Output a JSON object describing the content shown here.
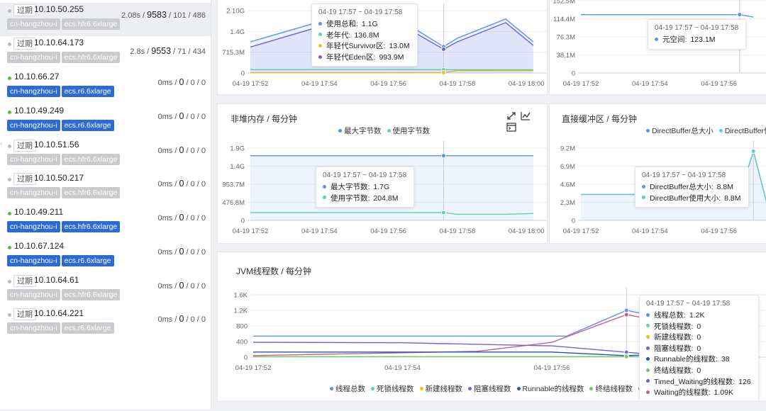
{
  "colors": {
    "blue": "#5b8ff9",
    "green": "#5ad8a6",
    "yellow": "#f6bd16",
    "purple": "#6d63d4",
    "dkblue": "#2952b8",
    "ltgreen": "#73c764",
    "pink": "#c75c94",
    "teal": "#64c9c9"
  },
  "sidebar": {
    "instances": [
      {
        "ip": "10.10.50.255",
        "expired": "过期",
        "status": "grey",
        "tags": [
          {
            "text": "cn-hangzhou-i",
            "c": "grey"
          },
          {
            "text": "ecs.hfr6.6xlarge",
            "c": "grey"
          }
        ],
        "time": "2.08s",
        "sep": " / ",
        "big": "9583",
        "rest": " / 101 / 486",
        "selected": true
      },
      {
        "ip": "10.10.64.173",
        "expired": "过期",
        "status": "grey",
        "tags": [
          {
            "text": "cn-hangzhou-i",
            "c": "grey"
          },
          {
            "text": "ecs.hfr6.6xlarge",
            "c": "grey"
          }
        ],
        "time": "2.8s",
        "sep": " / ",
        "big": "9553",
        "rest": " / 71 / 434"
      },
      {
        "ip": "10.10.66.27",
        "expired": "",
        "status": "green",
        "tags": [
          {
            "text": "cn-hangzhou-i",
            "c": "blue"
          },
          {
            "text": "ecs.r6.6xlarge",
            "c": "blue"
          }
        ],
        "time": "0ms",
        "sep": " / ",
        "big": "0",
        "rest": " / 0 / 0"
      },
      {
        "ip": "10.10.49.249",
        "expired": "",
        "status": "green",
        "tags": [
          {
            "text": "cn-hangzhou-i",
            "c": "blue"
          },
          {
            "text": "ecs.r6.6xlarge",
            "c": "blue"
          }
        ],
        "time": "0ms",
        "sep": " / ",
        "big": "0",
        "rest": " / 0 / 0"
      },
      {
        "ip": "10.10.51.56",
        "expired": "过期",
        "status": "grey",
        "tags": [
          {
            "text": "cn-hangzhou-i",
            "c": "grey"
          },
          {
            "text": "ecs.hfr6.6xlarge",
            "c": "grey"
          }
        ],
        "time": "0ms",
        "sep": " / ",
        "big": "0",
        "rest": " / 0 / 0"
      },
      {
        "ip": "10.10.50.217",
        "expired": "过期",
        "status": "grey",
        "tags": [
          {
            "text": "cn-hangzhou-i",
            "c": "grey"
          },
          {
            "text": "ecs.hfr6.6xlarge",
            "c": "grey"
          }
        ],
        "time": "0ms",
        "sep": " / ",
        "big": "0",
        "rest": " / 0 / 0"
      },
      {
        "ip": "10.10.49.211",
        "expired": "",
        "status": "green",
        "tags": [
          {
            "text": "cn-hangzhou-i",
            "c": "blue"
          },
          {
            "text": "ecs.hfr6.6xlarge",
            "c": "blue"
          }
        ],
        "time": "0ms",
        "sep": " / ",
        "big": "0",
        "rest": " / 0 / 0"
      },
      {
        "ip": "10.10.67.124",
        "expired": "",
        "status": "green",
        "tags": [
          {
            "text": "cn-hangzhou-i",
            "c": "blue"
          },
          {
            "text": "ecs.r6.6xlarge",
            "c": "blue"
          }
        ],
        "time": "0ms",
        "sep": " / ",
        "big": "0",
        "rest": " / 0 / 0"
      },
      {
        "ip": "10.10.64.61",
        "expired": "过期",
        "status": "grey",
        "tags": [
          {
            "text": "cn-hangzhou-i",
            "c": "grey"
          },
          {
            "text": "ecs.hfr6.6xlarge",
            "c": "grey"
          }
        ],
        "time": "0ms",
        "sep": " / ",
        "big": "0",
        "rest": " / 0 / 0"
      },
      {
        "ip": "10.10.64.221",
        "expired": "过期",
        "status": "grey",
        "tags": [
          {
            "text": "cn-hangzhou-i",
            "c": "grey"
          },
          {
            "text": "ecs.r6.6xlarge",
            "c": "grey"
          }
        ],
        "time": "0ms",
        "sep": " / ",
        "big": "0",
        "rest": " / 0 / 0"
      }
    ]
  },
  "chart_data": [
    {
      "id": "heap",
      "type": "area",
      "title": "",
      "x": [
        "04-19 17:52",
        "04-19 17:54",
        "04-19 17:56",
        "04-19 17:58",
        "04-19 18:00"
      ],
      "x_hidden_top": "2.6G",
      "y_ticks": [
        "0",
        "715.3M",
        "1.4G",
        "2.10G"
      ],
      "ylim": [
        0,
        2.6
      ],
      "unit": "G",
      "series": [
        {
          "name": "使用总和",
          "color": "blue",
          "fill": true,
          "points": [
            [
              0,
              1.3
            ],
            [
              1.2,
              2.3
            ],
            [
              2.1,
              2.35
            ],
            [
              2.8,
              1.1
            ],
            [
              3.0,
              1.45
            ],
            [
              3.7,
              2.25
            ],
            [
              4.1,
              1.3
            ]
          ]
        },
        {
          "name": "老年代",
          "color": "green",
          "points": [
            [
              0,
              0.14
            ],
            [
              4.1,
              0.137
            ]
          ]
        },
        {
          "name": "年轻代Survivor区",
          "color": "yellow",
          "points": [
            [
              0,
              0.013
            ],
            [
              2.8,
              0.013
            ],
            [
              3.0,
              0.1
            ],
            [
              4.1,
              0.1
            ]
          ]
        },
        {
          "name": "年轻代Eden区",
          "color": "purple",
          "fill": true,
          "points": [
            [
              0,
              1.08
            ],
            [
              1.2,
              2.1
            ],
            [
              2.1,
              2.15
            ],
            [
              2.8,
              0.99
            ],
            [
              3.0,
              1.3
            ],
            [
              3.7,
              2.1
            ],
            [
              4.1,
              1.15
            ]
          ]
        }
      ],
      "cursor_x": 2.8,
      "tooltip": {
        "title": "04-19 17:57 ~ 04-19 17:58",
        "rows": [
          [
            "使用总和:",
            "1.1G",
            "blue"
          ],
          [
            "老年代:",
            "136.8M",
            "green"
          ],
          [
            "年轻代Survivor区:",
            "13.0M",
            "yellow"
          ],
          [
            "年轻代Eden区:",
            "993.9M",
            "purple"
          ]
        ]
      }
    },
    {
      "id": "meta",
      "type": "line",
      "title": "",
      "x": [
        "04-19 17:52",
        "04-19 17:54",
        "04-19 17:56"
      ],
      "y_ticks": [
        "0",
        "38.1M",
        "76.3M",
        "114.4M",
        "152.5M"
      ],
      "ylim": [
        0,
        152.5
      ],
      "series": [
        {
          "name": "元空间",
          "color": "blue",
          "points": [
            [
              0,
              123.1
            ],
            [
              2.3,
              123.1
            ],
            [
              2.5,
              118
            ]
          ]
        }
      ],
      "cursor_x": 2.3,
      "tooltip": {
        "title": "04-19 17:57 ~ 04-19 17:58",
        "rows": [
          [
            "元空间:",
            "123.1M",
            "blue"
          ]
        ]
      }
    },
    {
      "id": "nonheap",
      "type": "area",
      "title": "非堆内存 / 每分钟",
      "x": [
        "04-19 17:52",
        "04-19 17:54",
        "04-19 17:56",
        "04-19 17:58",
        "04-19 18:00"
      ],
      "y_ticks": [
        "0",
        "476.8M",
        "953.7M",
        "1.4G",
        "1.9G"
      ],
      "ylim": [
        0,
        1.9
      ],
      "legend": [
        "最大字节数",
        "使用字节数"
      ],
      "series": [
        {
          "name": "最大字节数",
          "color": "blue",
          "fill": true,
          "points": [
            [
              0,
              1.7
            ],
            [
              4.1,
              1.7
            ]
          ]
        },
        {
          "name": "使用字节数",
          "color": "green",
          "points": [
            [
              0,
              0.205
            ],
            [
              2.8,
              0.205
            ],
            [
              3.0,
              0.16
            ],
            [
              3.7,
              0.16
            ],
            [
              4.1,
              0.18
            ]
          ]
        }
      ],
      "cursor_x": 2.8,
      "tooltip": {
        "title": "04-19 17:57 ~ 04-19 17:58",
        "rows": [
          [
            "最大字节数:",
            "1.7G",
            "blue"
          ],
          [
            "使用字节数:",
            "204.8M",
            "green"
          ]
        ]
      }
    },
    {
      "id": "direct",
      "type": "area",
      "title": "直接缓冲区 / 每分钟",
      "x": [
        "04-19 17:52",
        "04-19 17:54",
        "04-19 17:56"
      ],
      "y_ticks": [
        "0",
        "2.3M",
        "4.6M",
        "6.9M",
        "9.2M"
      ],
      "ylim": [
        0,
        9.2
      ],
      "legend": [
        "DirectBuffer总大小",
        "DirectBuffer使用"
      ],
      "series": [
        {
          "name": "DirectBuffer总大小",
          "color": "blue",
          "fill": true,
          "points": [
            [
              0,
              3.3
            ],
            [
              2.3,
              3.3
            ],
            [
              2.5,
              8.8
            ],
            [
              2.7,
              2.0
            ]
          ]
        },
        {
          "name": "DirectBuffer使用",
          "color": "teal",
          "points": [
            [
              0,
              3.3
            ],
            [
              2.3,
              3.3
            ],
            [
              2.5,
              8.8
            ],
            [
              2.7,
              2.0
            ]
          ]
        }
      ],
      "cursor_x": 2.5,
      "tooltip": {
        "title": "04-19 17:57 ~ 04-19 17:58",
        "rows": [
          [
            "DirectBuffer总大小:",
            "8.8M",
            "blue"
          ],
          [
            "DirectBuffer使用大小:",
            "8.8M",
            "teal"
          ]
        ]
      }
    },
    {
      "id": "threads",
      "type": "line",
      "title": "JVM线程数 / 每分钟",
      "x": [
        "04-19 17:52",
        "04-19 17:54",
        "04-19 17:56"
      ],
      "y_ticks": [
        "0",
        "400",
        "800",
        "1.2K",
        "1.6K"
      ],
      "ylim": [
        0,
        1600
      ],
      "legend": [
        "线程总数",
        "死锁线程数",
        "新建线程数",
        "阻塞线程数",
        "Runnable的线程数",
        "终结线程数",
        "Tim"
      ],
      "series": [
        {
          "name": "线程总数",
          "color": "blue",
          "points": [
            [
              0,
              540
            ],
            [
              2.1,
              540
            ],
            [
              2.5,
              1200
            ],
            [
              2.7,
              1050
            ]
          ]
        },
        {
          "name": "Waiting的线程数",
          "color": "pink",
          "points": [
            [
              0,
              40
            ],
            [
              1.5,
              150
            ],
            [
              2.0,
              380
            ],
            [
              2.5,
              1090
            ],
            [
              2.7,
              950
            ]
          ]
        },
        {
          "name": "Timed_Waiting的线程数",
          "color": "purple",
          "points": [
            [
              0,
              380
            ],
            [
              1.0,
              370
            ],
            [
              2.0,
              290
            ],
            [
              2.5,
              126
            ],
            [
              2.7,
              60
            ]
          ]
        },
        {
          "name": "Runnable的线程数",
          "color": "dkblue",
          "points": [
            [
              0,
              130
            ],
            [
              2.0,
              130
            ],
            [
              2.5,
              38
            ],
            [
              2.7,
              70
            ]
          ]
        },
        {
          "name": "死锁线程数",
          "color": "ltgreen",
          "points": [
            [
              0,
              12
            ],
            [
              2.7,
              12
            ]
          ]
        }
      ],
      "cursor_x": 2.5,
      "tooltip": {
        "title": "04-19 17:57 ~ 04-19 17:58",
        "rows": [
          [
            "线程总数:",
            "1.2K",
            "blue"
          ],
          [
            "死锁线程数:",
            "0",
            "green"
          ],
          [
            "新建线程数:",
            "0",
            "yellow"
          ],
          [
            "阻塞线程数:",
            "0",
            "purple"
          ],
          [
            "Runnable的线程数:",
            "38",
            "dkblue"
          ],
          [
            "终结线程数:",
            "0",
            "ltgreen"
          ],
          [
            "Timed_Waiting的线程数:",
            "126",
            "purple"
          ],
          [
            "Waiting的线程数:",
            "1.09K",
            "pink"
          ]
        ]
      }
    }
  ],
  "legend_colors": {
    "线程总数": "blue",
    "死锁线程数": "green",
    "新建线程数": "yellow",
    "阻塞线程数": "purple",
    "Runnable的线程数": "dkblue",
    "终结线程数": "ltgreen",
    "Tim": "purple",
    "最大字节数": "blue",
    "使用字节数": "green",
    "DirectBuffer总大小": "blue",
    "DirectBuffer使用": "teal"
  },
  "toolbar": {
    "icons": [
      "expand-icon",
      "line-chart-icon",
      "terminal-icon"
    ]
  }
}
